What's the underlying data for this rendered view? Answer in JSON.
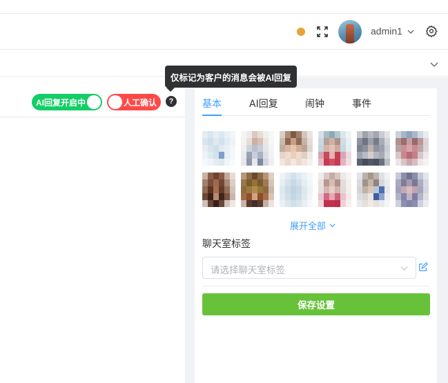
{
  "header": {
    "username": "admin1",
    "icons": {
      "status_dot": "status-dot",
      "fullscreen": "fullscreen-icon",
      "user_menu": "chevron-down-icon",
      "settings": "gear-icon"
    },
    "status_color": "#e8a33d"
  },
  "tooltip": {
    "text": "仅标记为客户的消息会被AI回复"
  },
  "left_toolbar": {
    "ai_reply_toggle": {
      "label": "AI回复开启中",
      "state": "on",
      "color": "#13ce66"
    },
    "manual_confirm_toggle": {
      "label": "人工确认",
      "state": "off",
      "color": "#ff4949"
    },
    "help_label": "?"
  },
  "right_panel": {
    "tabs": [
      {
        "label": "基本",
        "active": true
      },
      {
        "label": "AI回复",
        "active": false
      },
      {
        "label": "闹钟",
        "active": false
      },
      {
        "label": "事件",
        "active": false
      }
    ],
    "expand_all_label": "展开全部",
    "chat_tags_label": "聊天室标签",
    "chat_tags_select": {
      "placeholder": "请选择聊天室标签"
    },
    "save_label": "保存设置",
    "accent_color": "#409eff",
    "save_color": "#67c23a"
  }
}
